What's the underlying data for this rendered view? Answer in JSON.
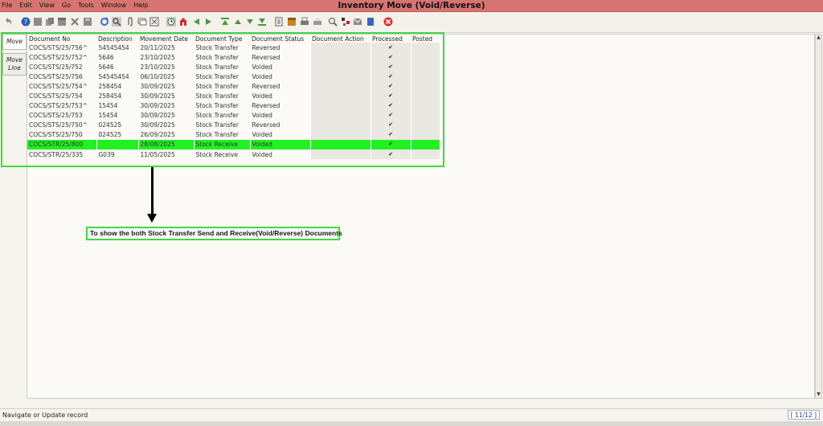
{
  "window": {
    "title": "Inventory Move (Void/Reverse)"
  },
  "menu": [
    "File",
    "Edit",
    "View",
    "Go",
    "Tools",
    "Window",
    "Help"
  ],
  "toolbar_icons": [
    "undo-icon",
    "help-icon",
    "new-icon",
    "copy-icon",
    "delete-icon",
    "delete-selection-icon",
    "save-icon",
    "refresh-icon",
    "find-icon",
    "attachment-icon",
    "chat-icon",
    "grid-toggle-icon",
    "history-icon",
    "home-icon",
    "previous-icon",
    "next-icon",
    "first-icon",
    "previous-record-icon",
    "next-record-icon",
    "last-icon",
    "report-icon",
    "archive-icon",
    "print-icon",
    "print-preview-icon",
    "zoom-across-icon",
    "active-workflows-icon",
    "requests-icon",
    "product-info-icon",
    "close-window-icon"
  ],
  "tabs": {
    "move": "Move",
    "move_line": "Move Line"
  },
  "columns": [
    "Document No",
    "Description",
    "Movement Date",
    "Document Type",
    "Document Status",
    "Document Action",
    "Processed",
    "Posted"
  ],
  "rows": [
    {
      "doc_no": "COCS/STS/25/756^",
      "description": "54545454",
      "date": "20/11/2025",
      "type": "Stock Transfer",
      "status": "Reversed",
      "action": "",
      "processed": "✔",
      "posted": ""
    },
    {
      "doc_no": "COCS/STS/25/752^",
      "description": "5646",
      "date": "23/10/2025",
      "type": "Stock Transfer",
      "status": "Reversed",
      "action": "",
      "processed": "✔",
      "posted": ""
    },
    {
      "doc_no": "COCS/STS/25/752",
      "description": "5646",
      "date": "23/10/2025",
      "type": "Stock Transfer",
      "status": "Voided",
      "action": "",
      "processed": "✔",
      "posted": ""
    },
    {
      "doc_no": "COCS/STS/25/756",
      "description": "54545454",
      "date": "06/10/2025",
      "type": "Stock Transfer",
      "status": "Voided",
      "action": "",
      "processed": "✔",
      "posted": ""
    },
    {
      "doc_no": "COCS/STS/25/754^",
      "description": "258454",
      "date": "30/09/2025",
      "type": "Stock Transfer",
      "status": "Reversed",
      "action": "",
      "processed": "✔",
      "posted": ""
    },
    {
      "doc_no": "COCS/STS/25/754",
      "description": "258454",
      "date": "30/09/2025",
      "type": "Stock Transfer",
      "status": "Voided",
      "action": "",
      "processed": "✔",
      "posted": ""
    },
    {
      "doc_no": "COCS/STS/25/753^",
      "description": "15454",
      "date": "30/09/2025",
      "type": "Stock Transfer",
      "status": "Reversed",
      "action": "",
      "processed": "✔",
      "posted": ""
    },
    {
      "doc_no": "COCS/STS/25/753",
      "description": "15454",
      "date": "30/09/2025",
      "type": "Stock Transfer",
      "status": "Voided",
      "action": "",
      "processed": "✔",
      "posted": ""
    },
    {
      "doc_no": "COCS/STS/25/750^",
      "description": "024525",
      "date": "30/09/2025",
      "type": "Stock Transfer",
      "status": "Reversed",
      "action": "",
      "processed": "✔",
      "posted": ""
    },
    {
      "doc_no": "COCS/STS/25/750",
      "description": "024525",
      "date": "26/09/2025",
      "type": "Stock Transfer",
      "status": "Voided",
      "action": "",
      "processed": "✔",
      "posted": ""
    },
    {
      "doc_no": "COCS/STR/25/800",
      "description": "",
      "date": "28/08/2025",
      "type": "Stock Receive",
      "status": "Voided",
      "action": "",
      "processed": "✔",
      "posted": "",
      "selected": true
    },
    {
      "doc_no": "COCS/STR/25/335",
      "description": "G039",
      "date": "11/05/2025",
      "type": "Stock Receive",
      "status": "Voided",
      "action": "",
      "processed": "✔",
      "posted": ""
    }
  ],
  "annotation": {
    "text": "To show the both Stock Transfer Send and Receive(Void/Reverse) Documents"
  },
  "status": {
    "message": "Navigate or Update record",
    "record_count": "[ 11/12 ]"
  },
  "colors": {
    "title_bar": "#d77472",
    "highlight_green": "#21f021",
    "annotation_border": "#3fd93f"
  }
}
